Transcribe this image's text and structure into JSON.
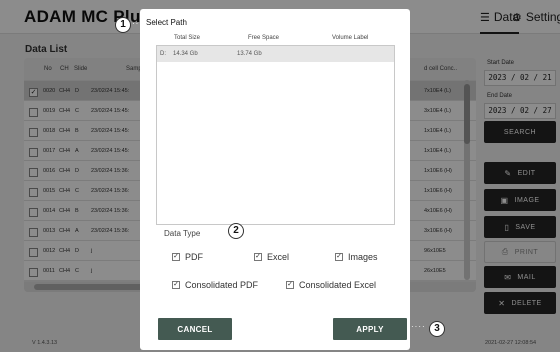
{
  "app": {
    "title": "ADAM MC Plus",
    "tabs": [
      {
        "label": "Data",
        "icon": "list-icon"
      },
      {
        "label": "Setting",
        "icon": "gear-icon"
      }
    ],
    "version": "V 1.4.3.13",
    "timestamp": "2021-02-27 12:08:54"
  },
  "data_list": {
    "title": "Data List",
    "columns": [
      "No",
      "CH",
      "Slide",
      "Samp",
      "d cell Conc.."
    ],
    "rows": [
      {
        "no": "0020",
        "ch": "CH4",
        "slide": "D",
        "date": "23/02/24 15:45:",
        "conc": "7x10E4 (L)",
        "checked": true
      },
      {
        "no": "0019",
        "ch": "CH4",
        "slide": "C",
        "date": "23/02/24 15:45:",
        "conc": "3x10E4 (L)",
        "checked": false
      },
      {
        "no": "0018",
        "ch": "CH4",
        "slide": "B",
        "date": "23/02/24 15:45:",
        "conc": "1x10E4 (L)",
        "checked": false
      },
      {
        "no": "0017",
        "ch": "CH4",
        "slide": "A",
        "date": "23/02/24 15:45:",
        "conc": "1x10E4 (L)",
        "checked": false
      },
      {
        "no": "0016",
        "ch": "CH4",
        "slide": "D",
        "date": "23/02/24 15:36:",
        "conc": "1x10E6 (H)",
        "checked": false
      },
      {
        "no": "0015",
        "ch": "CH4",
        "slide": "C",
        "date": "23/02/24 15:36:",
        "conc": "1x10E6 (H)",
        "checked": false
      },
      {
        "no": "0014",
        "ch": "CH4",
        "slide": "B",
        "date": "23/02/24 15:36:",
        "conc": "4x10E6 (H)",
        "checked": false
      },
      {
        "no": "0013",
        "ch": "CH4",
        "slide": "A",
        "date": "23/02/24 15:36:",
        "conc": "3x10E6 (H)",
        "checked": false
      },
      {
        "no": "0012",
        "ch": "CH4",
        "slide": "D",
        "date": "j",
        "conc": "96x10E5",
        "checked": false
      },
      {
        "no": "0011",
        "ch": "CH4",
        "slide": "C",
        "date": "j",
        "conc": "26x10E5",
        "checked": false
      }
    ]
  },
  "filters": {
    "start_label": "Start Date",
    "start_value": "2023 / 02 / 21",
    "end_label": "End Date",
    "end_value": "2023 / 02 / 27",
    "search": "SEARCH"
  },
  "actions": {
    "edit": "EDIT",
    "image": "IMAGE",
    "save": "SAVE",
    "print": "PRINT",
    "mail": "MAIL",
    "delete": "DELETE"
  },
  "dialog": {
    "title": "Select Path",
    "headers": {
      "total": "Total Size",
      "free": "Free Space",
      "volume": "Volume Label"
    },
    "paths": [
      {
        "drive": "D:",
        "total": "14.34 Gb",
        "free": "13.74 Gb",
        "volume": ""
      }
    ],
    "data_type_label": "Data Type",
    "options": [
      {
        "label": "PDF",
        "checked": true
      },
      {
        "label": "Excel",
        "checked": true
      },
      {
        "label": "Images",
        "checked": true
      },
      {
        "label": "Consolidated PDF",
        "checked": true
      },
      {
        "label": "Consolidated Excel",
        "checked": true
      }
    ],
    "cancel": "CANCEL",
    "apply": "APPLY"
  },
  "callouts": [
    "1",
    "2",
    "3"
  ]
}
